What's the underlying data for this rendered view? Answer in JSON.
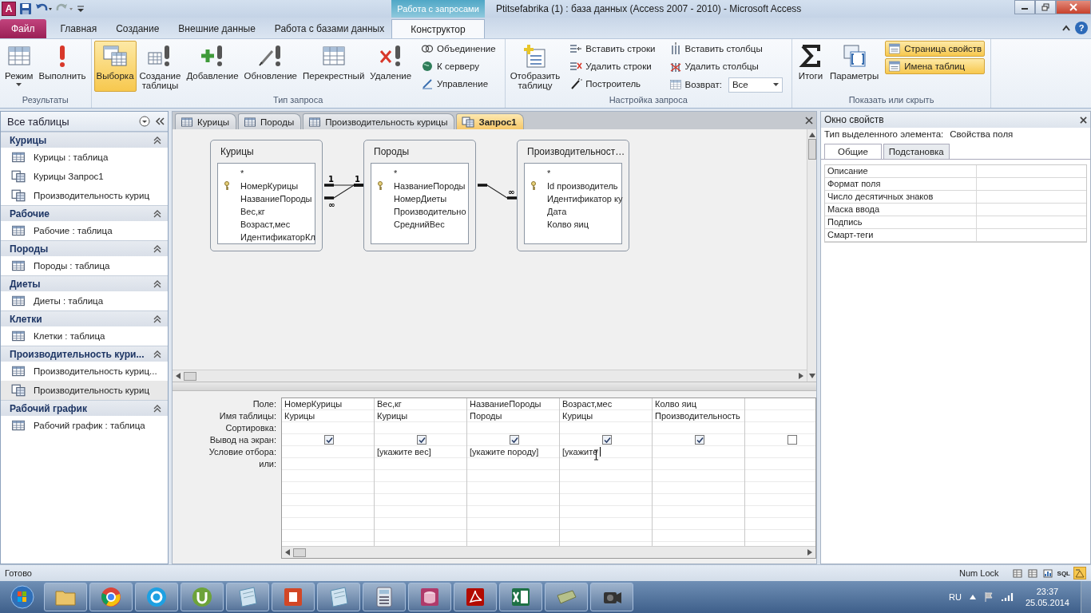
{
  "window": {
    "app_logo": "A",
    "title": "Ptitsefabrika (1) : база данных (Access 2007 - 2010)  -  Microsoft Access",
    "context_tab": "Работа с запросами",
    "help": "?"
  },
  "ribbon_tabs": [
    {
      "label": "Файл",
      "kind": "file",
      "selected": false
    },
    {
      "label": "Главная",
      "kind": "tab",
      "selected": false
    },
    {
      "label": "Создание",
      "kind": "tab",
      "selected": false
    },
    {
      "label": "Внешние данные",
      "kind": "tab",
      "selected": false
    },
    {
      "label": "Работа с базами данных",
      "kind": "tab",
      "selected": false
    },
    {
      "label": "Конструктор",
      "kind": "context",
      "selected": true
    }
  ],
  "ribbon_groups": [
    {
      "label": "Результаты",
      "items": [
        {
          "label": "Режим",
          "kind": "split",
          "selected": false
        },
        {
          "label": "Выполнить",
          "kind": "large",
          "selected": false
        }
      ]
    },
    {
      "label": "Тип запроса",
      "items": [
        {
          "label": "Выборка",
          "kind": "large",
          "selected": true
        },
        {
          "label": "Создание\nтаблицы",
          "kind": "large",
          "selected": false
        },
        {
          "label": "Добавление",
          "kind": "large",
          "selected": false
        },
        {
          "label": "Обновление",
          "kind": "large",
          "selected": false
        },
        {
          "label": "Перекрестный",
          "kind": "large",
          "selected": false
        },
        {
          "label": "Удаление",
          "kind": "large",
          "selected": false
        },
        {
          "label": "Объединение",
          "kind": "small",
          "selected": false
        },
        {
          "label": "К серверу",
          "kind": "small",
          "selected": false
        },
        {
          "label": "Управление",
          "kind": "small",
          "selected": false
        }
      ]
    },
    {
      "label": "Настройка запроса",
      "items": [
        {
          "label": "Отобразить\nтаблицу",
          "kind": "large",
          "selected": false
        },
        {
          "label": "Вставить строки",
          "kind": "small",
          "selected": false
        },
        {
          "label": "Удалить строки",
          "kind": "small",
          "selected": false
        },
        {
          "label": "Построитель",
          "kind": "small",
          "selected": false
        },
        {
          "label": "Вставить столбцы",
          "kind": "small",
          "selected": false
        },
        {
          "label": "Удалить столбцы",
          "kind": "small",
          "selected": false
        },
        {
          "label": "Возврат:",
          "kind": "combo",
          "value": "Все",
          "selected": false
        }
      ]
    },
    {
      "label": "Показать или скрыть",
      "items": [
        {
          "label": "Итоги",
          "kind": "large",
          "selected": false
        },
        {
          "label": "Параметры",
          "kind": "large",
          "selected": false
        },
        {
          "label": "Страница свойств",
          "kind": "small",
          "selected": true
        },
        {
          "label": "Имена таблиц",
          "kind": "small",
          "selected": true
        }
      ]
    }
  ],
  "navigation": {
    "title": "Все таблицы",
    "groups": [
      {
        "name": "Курицы",
        "items": [
          {
            "label": "Курицы : таблица",
            "kind": "table",
            "selected": false
          },
          {
            "label": "Курицы Запрос1",
            "kind": "query",
            "selected": false
          },
          {
            "label": "Производительность куриц",
            "kind": "query",
            "selected": false
          }
        ]
      },
      {
        "name": "Рабочие",
        "items": [
          {
            "label": "Рабочие : таблица",
            "kind": "table",
            "selected": false
          }
        ]
      },
      {
        "name": "Породы",
        "items": [
          {
            "label": "Породы : таблица",
            "kind": "table",
            "selected": false
          }
        ]
      },
      {
        "name": "Диеты",
        "items": [
          {
            "label": "Диеты : таблица",
            "kind": "table",
            "selected": false
          }
        ]
      },
      {
        "name": "Клетки",
        "items": [
          {
            "label": "Клетки : таблица",
            "kind": "table",
            "selected": false
          }
        ]
      },
      {
        "name": "Производительность кури...",
        "items": [
          {
            "label": "Производительность куриц...",
            "kind": "table",
            "selected": false
          },
          {
            "label": "Производительность куриц",
            "kind": "query",
            "selected": true
          }
        ]
      },
      {
        "name": "Рабочий график",
        "items": [
          {
            "label": "Рабочий график : таблица",
            "kind": "table",
            "selected": false
          }
        ]
      }
    ]
  },
  "document_tabs": [
    {
      "label": "Курицы",
      "kind": "table",
      "selected": false
    },
    {
      "label": "Породы",
      "kind": "table",
      "selected": false
    },
    {
      "label": "Производительность курицы",
      "kind": "table",
      "selected": false
    },
    {
      "label": "Запрос1",
      "kind": "query",
      "selected": true
    }
  ],
  "query_design": {
    "tables": [
      {
        "title": "Курицы",
        "fields": [
          {
            "name": "*",
            "key": false
          },
          {
            "name": "НомерКурицы",
            "key": true
          },
          {
            "name": "НазваниеПороды",
            "key": false
          },
          {
            "name": "Вес,кг",
            "key": false
          },
          {
            "name": "Возраст,мес",
            "key": false
          },
          {
            "name": "ИдентификаторКл",
            "key": false
          }
        ]
      },
      {
        "title": "Породы",
        "fields": [
          {
            "name": "*",
            "key": false
          },
          {
            "name": "НазваниеПороды",
            "key": true
          },
          {
            "name": "НомерДиеты",
            "key": false
          },
          {
            "name": "Производительно",
            "key": false
          },
          {
            "name": "СреднийВес",
            "key": false
          }
        ]
      },
      {
        "title": "Производительност…",
        "fields": [
          {
            "name": "*",
            "key": false
          },
          {
            "name": "Id производитель",
            "key": true
          },
          {
            "name": "Идентификатор ку",
            "key": false
          },
          {
            "name": "Дата",
            "key": false
          },
          {
            "name": "Колво яиц",
            "key": false
          }
        ]
      }
    ],
    "relationships": [
      {
        "from_label": "1",
        "to_label": "1"
      },
      {
        "from_label": "∞"
      },
      {
        "to_label": "∞"
      }
    ],
    "grid": {
      "row_labels": [
        "Поле:",
        "Имя таблицы:",
        "Сортировка:",
        "Вывод на экран:",
        "Условие отбора:",
        "или:"
      ],
      "columns": [
        {
          "field": "НомерКурицы",
          "table": "Курицы",
          "show": true
        },
        {
          "field": "Вес,кг",
          "table": "Курицы",
          "show": true,
          "criteria": "[укажите вес]"
        },
        {
          "field": "НазваниеПороды",
          "table": "Породы",
          "show": true,
          "criteria": "[укажите породу]"
        },
        {
          "field": "Возраст,мес",
          "table": "Курицы",
          "show": true,
          "criteria": "[укажите",
          "editing": true
        },
        {
          "field": "Колво яиц",
          "table": "Производительность",
          "show": true
        },
        {
          "show": false
        }
      ]
    }
  },
  "property_sheet": {
    "title": "Окно свойств",
    "selection_label": "Тип выделенного элемента:",
    "selection_value": "Свойства поля",
    "tabs": [
      {
        "label": "Общие",
        "selected": true
      },
      {
        "label": "Подстановка",
        "selected": false
      }
    ],
    "properties": [
      {
        "name": "Описание"
      },
      {
        "name": "Формат поля"
      },
      {
        "name": "Число десятичных знаков"
      },
      {
        "name": "Маска ввода"
      },
      {
        "name": "Подпись"
      },
      {
        "name": "Смарт-теги"
      }
    ]
  },
  "status_bar": {
    "text": "Готово",
    "indicator": "Num Lock",
    "views": [
      {
        "kind": "datasheet",
        "selected": false
      },
      {
        "kind": "pivot-table",
        "selected": false
      },
      {
        "kind": "pivot-chart",
        "selected": false
      },
      {
        "kind": "sql",
        "label": "SQL",
        "selected": false
      },
      {
        "kind": "design",
        "selected": true
      }
    ]
  },
  "taskbar": {
    "language": "RU",
    "time": "23:37",
    "date": "25.05.2014"
  }
}
